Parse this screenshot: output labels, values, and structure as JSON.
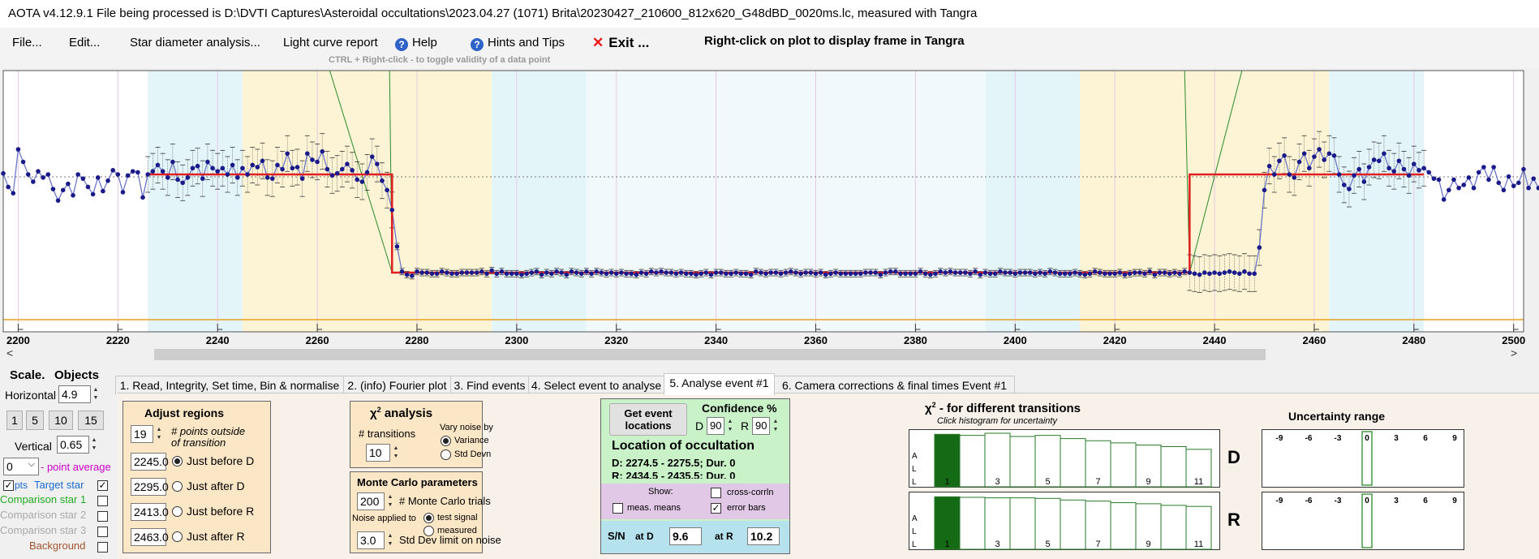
{
  "titlebar": {
    "text": "AOTA v4.12.9.1    File being processed is D:\\DVTI Captures\\Asteroidal occultations\\2023.04.27 (1071) Brita\\20230427_210600_812x620_G48dBD_0020ms.lc, measured with Tangra"
  },
  "menu": {
    "file": "File...",
    "edit": "Edit...",
    "star_diameter": "Star diameter analysis...",
    "light_curve": "Light curve report",
    "help": "Help",
    "hints": "Hints and Tips",
    "exit": "Exit ...",
    "right_click": "Right-click on plot to display frame in Tangra",
    "hint": "CTRL + Right-click  -  to toggle validity of a data point"
  },
  "chart_data": {
    "type": "line",
    "xlim": [
      2197,
      2502
    ],
    "x_ticks": [
      2200,
      2220,
      2240,
      2260,
      2280,
      2300,
      2320,
      2340,
      2360,
      2380,
      2400,
      2420,
      2440,
      2460,
      2480,
      2500
    ],
    "regions": [
      {
        "from": 2226,
        "to": 2245,
        "color": "#e4f5f9"
      },
      {
        "from": 2245,
        "to": 2274,
        "color": "#fcf4d4"
      },
      {
        "from": 2274,
        "to": 2295,
        "color": "#fcf4d4"
      },
      {
        "from": 2295,
        "to": 2314,
        "color": "#e4f5f9"
      },
      {
        "from": 2394,
        "to": 2413,
        "color": "#e4f5f9"
      },
      {
        "from": 2413,
        "to": 2434,
        "color": "#fcf4d4"
      },
      {
        "from": 2434,
        "to": 2463,
        "color": "#fcf4d4"
      },
      {
        "from": 2463,
        "to": 2482,
        "color": "#e4f5f9"
      }
    ],
    "model": {
      "d_time": 2275,
      "r_time": 2435,
      "baseline": 1.0,
      "bottom": 0.06
    },
    "series": [
      {
        "x_start": 2197,
        "values": [
          1.01,
          0.88,
          0.82,
          1.24,
          1.12,
          1.0,
          0.93,
          1.03,
          0.97,
          1.0,
          0.86,
          0.75,
          0.85,
          0.91,
          0.8,
          1.0,
          0.96,
          0.88,
          0.81,
          0.97,
          0.84,
          0.94,
          1.04,
          1.0,
          0.83,
          0.99,
          1.03,
          1.02,
          0.78,
          1.0,
          1.03,
          1.09,
          1.03,
          0.97,
          1.12,
          0.95,
          0.92,
          0.97,
          1.06,
          1.08,
          0.96,
          1.12,
          1.06,
          1.03,
          1.06,
          1.0,
          1.09,
          0.97,
          1.06,
          1.0,
          1.09,
          1.07,
          1.13,
          0.97,
          0.96,
          1.09,
          1.05,
          1.2,
          1.06,
          1.07,
          0.96,
          1.2,
          1.14,
          1.12,
          1.22,
          1.05,
          0.99,
          1.01,
          1.05,
          1.1,
          1.04,
          0.95,
          0.93,
          1.02,
          1.17,
          1.1,
          0.94,
          0.85,
          0.66,
          0.31,
          0.07,
          0.04,
          0.03,
          0.07,
          0.06,
          0.06,
          0.05,
          0.05,
          0.07,
          0.06,
          0.05,
          0.05,
          0.06,
          0.06,
          0.06,
          0.06,
          0.07,
          0.05,
          0.08,
          0.05,
          0.07,
          0.05,
          0.05,
          0.05,
          0.04,
          0.05,
          0.06,
          0.07,
          0.04,
          0.06,
          0.05,
          0.07,
          0.06,
          0.04,
          0.07,
          0.06,
          0.05,
          0.07,
          0.05,
          0.07,
          0.06,
          0.05,
          0.06,
          0.05,
          0.06,
          0.05,
          0.05,
          0.04,
          0.06,
          0.05,
          0.07,
          0.06,
          0.07,
          0.06,
          0.06,
          0.05,
          0.06,
          0.05,
          0.05,
          0.04,
          0.05,
          0.06,
          0.04,
          0.06,
          0.06,
          0.05,
          0.05,
          0.06,
          0.05,
          0.05,
          0.04,
          0.07,
          0.06,
          0.05,
          0.06,
          0.06,
          0.05,
          0.06,
          0.07,
          0.06,
          0.05,
          0.06,
          0.06,
          0.05,
          0.06,
          0.04,
          0.05,
          0.06,
          0.05,
          0.05,
          0.05,
          0.05,
          0.05,
          0.06,
          0.06,
          0.06,
          0.04,
          0.06,
          0.07,
          0.07,
          0.05,
          0.05,
          0.05,
          0.05,
          0.07,
          0.05,
          0.04,
          0.05,
          0.07,
          0.06,
          0.07,
          0.06,
          0.06,
          0.06,
          0.05,
          0.07,
          0.04,
          0.06,
          0.05,
          0.05,
          0.07,
          0.06,
          0.06,
          0.05,
          0.06,
          0.06,
          0.06,
          0.05,
          0.06,
          0.05,
          0.07,
          0.06,
          0.05,
          0.05,
          0.05,
          0.06,
          0.05,
          0.04,
          0.05,
          0.07,
          0.06,
          0.05,
          0.05,
          0.05,
          0.06,
          0.04,
          0.05,
          0.06,
          0.06,
          0.05,
          0.07,
          0.04,
          0.06,
          0.06,
          0.05,
          0.06,
          0.05,
          0.07,
          0.06,
          0.05,
          0.04,
          0.06,
          0.05,
          0.06,
          0.05,
          0.06,
          0.07,
          0.06,
          0.05,
          0.07,
          0.05,
          0.05,
          0.3,
          0.85,
          1.08,
          1.0,
          1.13,
          1.18,
          1.0,
          0.97,
          1.12,
          1.2,
          1.06,
          1.17,
          1.24,
          1.14,
          1.2,
          1.18,
          1.0,
          0.9,
          0.86,
          0.99,
          1.05,
          0.93,
          1.07,
          1.14,
          1.13,
          1.2,
          1.06,
          1.03,
          1.13,
          1.05,
          0.99,
          1.1,
          1.04,
          1.06,
          1.02,
          0.96,
          0.95,
          0.76,
          0.85,
          0.95,
          0.87,
          0.9,
          0.97,
          0.87,
          1.02,
          1.07,
          0.95,
          1.07,
          0.92,
          0.85,
          0.98,
          0.89,
          0.92,
          1.05,
          0.87,
          0.96,
          0.87,
          0.98,
          1.0,
          0.91,
          0.9,
          0.92,
          0.88,
          1.03,
          1.06,
          1.08,
          0.97,
          0.84,
          0.93,
          1.03,
          0.98,
          1.1,
          1.12,
          1.13,
          0.97,
          1.11,
          0.97,
          1.09,
          1.0,
          1.05,
          0.96,
          1.04,
          1.0,
          1.14,
          1.11,
          1.16,
          1.0,
          0.96,
          0.88,
          0.85,
          0.92,
          0.92,
          0.87,
          0.95,
          0.94,
          0.83,
          0.88,
          0.97,
          0.99,
          0.91,
          0.97,
          0.93,
          0.88,
          0.95,
          0.88,
          0.96,
          0.93,
          0.89,
          0.98,
          0.94,
          0.88,
          0.85,
          0.9,
          0.83,
          0.93,
          0.84,
          0.89,
          0.88,
          0.93,
          0.92,
          0.89,
          0.96,
          0.92,
          0.97,
          1.02,
          1.1,
          1.07,
          1.01,
          0.97,
          0.91,
          1.05,
          1.12,
          1.15,
          1.01,
          0.95,
          1.06,
          1.09,
          1.02,
          1.07,
          1.11,
          1.0,
          0.9,
          0.88,
          0.93,
          1.0
        ]
      }
    ]
  },
  "scale": {
    "title": "Scale.",
    "objects": "Objects",
    "horizontal_label": "Horizontal",
    "horizontal_value": "4.9",
    "vertical_label": "Vertical",
    "vertical_value": "0.65",
    "btn1": "1",
    "btn5": "5",
    "btn10": "10",
    "btn15": "15",
    "average_value": "0",
    "average_label": "- point average",
    "pts": "pts",
    "target": "Target star",
    "comp1": "Comparison star 1",
    "comp2": "Comparison star 2",
    "comp3": "Comparison star 3",
    "background": "Background"
  },
  "tabs": [
    "1.  Read, Integrity, Set time, Bin & normalise",
    "2. (info)  Fourier plot",
    "3. Find events",
    "4. Select event to analyse",
    "5. Analyse event #1",
    "6. Camera corrections & final times Event #1"
  ],
  "adjust": {
    "title": "Adjust regions",
    "points_value": "19",
    "points_label1": "# points outside",
    "points_label2": "of transition",
    "r1_value": "2245.0",
    "r1_label": "Just before D",
    "r2_value": "2295.0",
    "r2_label": "Just after D",
    "r3_value": "2413.0",
    "r3_label": "Just before R",
    "r4_value": "2463.0",
    "r4_label": "Just after R"
  },
  "chi": {
    "title_chi": "χ",
    "title_sup": "2",
    "title_rest": " analysis",
    "transitions_label": "# transitions",
    "transitions_value": "10",
    "vary_label": "Vary noise by",
    "variance": "Variance",
    "stddev": "Std Devn"
  },
  "monte": {
    "title": "Monte Carlo parameters",
    "trials_value": "200",
    "trials_label": "# Monte Carlo trials",
    "noise_label": "Noise applied to",
    "test_signal": "test signal",
    "measured": "measured",
    "std_value": "3.0",
    "std_label": "Std Dev limit on noise"
  },
  "event": {
    "get_button_l1": "Get event",
    "get_button_l2": "locations",
    "confidence": "Confidence %",
    "d_label": "D",
    "d_value": "90",
    "r_label": "R",
    "r_value": "90",
    "location_title": "Location of occultation",
    "d_line": "D: 2274.5 - 2275.5; Dur. 0",
    "r_line": "R: 2434.5 - 2435.5; Dur. 0",
    "show": "Show:",
    "cross": "cross-corrln",
    "means": "meas. means",
    "errbars": "error bars",
    "errbars_check": "✓",
    "sn": "S/N",
    "at_d": "at D",
    "sn_d": "9.6",
    "at_r": "at R",
    "sn_r": "10.2"
  },
  "hist": {
    "title_chi": "χ",
    "title_sup": "2",
    "title_rest": " - for different transitions",
    "subtitle": "Click histogram for uncertainty",
    "D": "D",
    "R": "R",
    "a": "A",
    "l": "L",
    "l2": "L",
    "values_d": [
      0.98,
      0.96,
      1.0,
      0.94,
      0.96,
      0.9,
      0.86,
      0.82,
      0.78,
      0.75,
      0.7
    ],
    "values_r": [
      0.98,
      0.97,
      0.96,
      0.96,
      0.95,
      0.92,
      0.9,
      0.87,
      0.85,
      0.82,
      0.8
    ],
    "ticks": [
      "1",
      "3",
      "5",
      "7",
      "9",
      "11"
    ]
  },
  "unc": {
    "title": "Uncertainty range",
    "ticks": [
      "-9",
      "-6",
      "-3",
      "0",
      "3",
      "6",
      "9"
    ]
  }
}
